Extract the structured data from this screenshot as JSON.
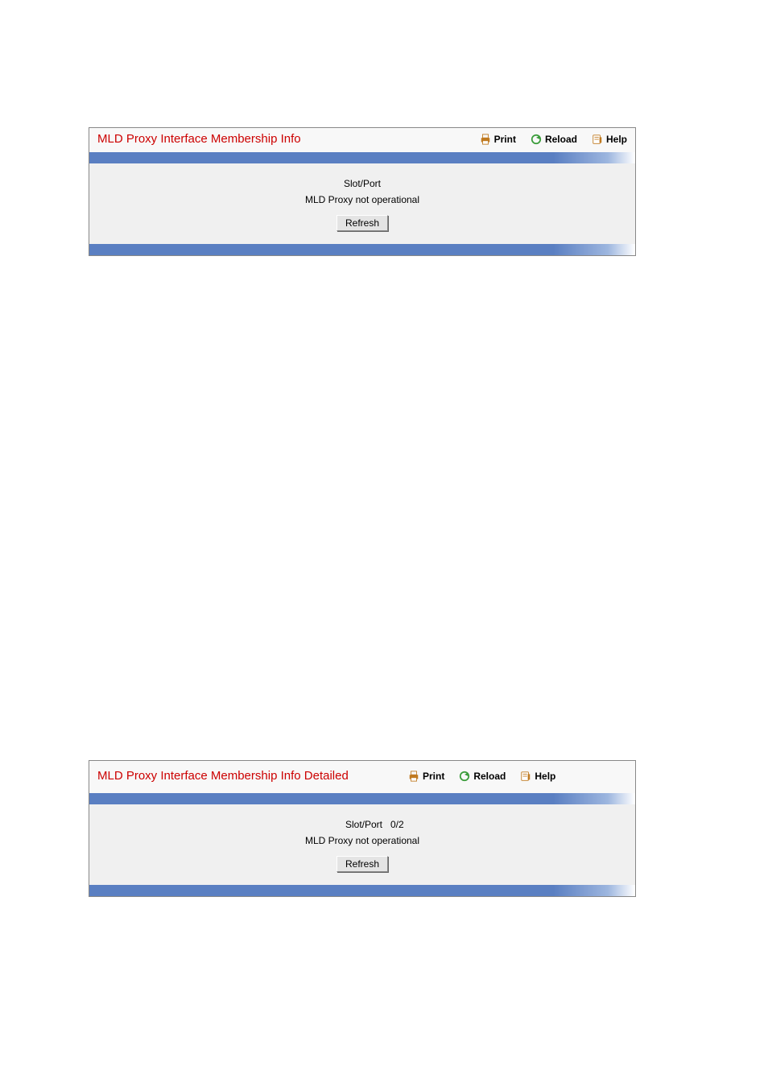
{
  "toolbar": {
    "print": "Print",
    "reload": "Reload",
    "help": "Help"
  },
  "panel1": {
    "title": "MLD Proxy Interface Membership Info",
    "slot_port_label": "Slot/Port",
    "slot_port_value": "",
    "status": "MLD Proxy not operational",
    "refresh": "Refresh"
  },
  "panel2": {
    "title": "MLD Proxy Interface Membership Info Detailed",
    "slot_port_label": "Slot/Port",
    "slot_port_value": "0/2",
    "status": "MLD Proxy not operational",
    "refresh": "Refresh"
  }
}
